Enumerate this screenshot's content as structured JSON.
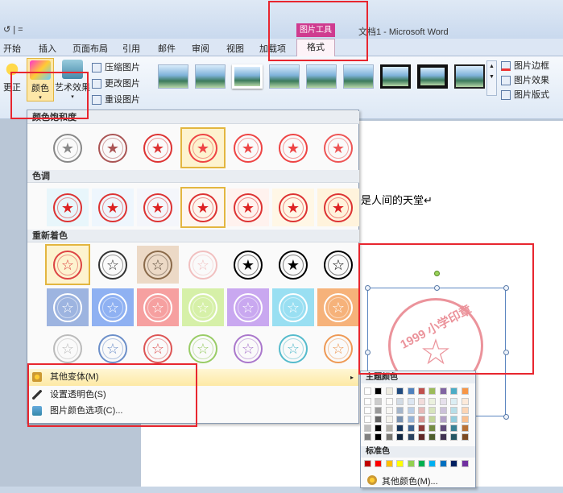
{
  "window": {
    "title": "文档1 - Microsoft Word",
    "quick_access": "↺ | ="
  },
  "context_group": "图片工具",
  "tabs": [
    "开始",
    "插入",
    "页面布局",
    "引用",
    "邮件",
    "审阅",
    "视图",
    "加载项",
    "格式"
  ],
  "active_tab": "格式",
  "ribbon": {
    "adjust": {
      "correct_label": "更正",
      "color_label": "颜色",
      "artistic_label": "艺术效果",
      "compress_label": "压缩图片",
      "change_label": "更改图片",
      "reset_label": "重设图片"
    },
    "right": {
      "border_label": "图片边框",
      "effects_label": "图片效果",
      "layout_label": "图片版式"
    }
  },
  "color_panel": {
    "sections": [
      "颜色饱和度",
      "色调",
      "重新着色"
    ],
    "stamp_text": "1999 小学印章"
  },
  "menu": {
    "more_variations": "其他变体(M)",
    "set_transparent": "设置透明色(S)",
    "color_options": "图片颜色选项(C)..."
  },
  "submenu": {
    "theme_label": "主题颜色",
    "standard_label": "标准色",
    "more_colors": "其他颜色(M)...",
    "theme_top": [
      "#ffffff",
      "#000000",
      "#eeece1",
      "#1f497d",
      "#4f81bd",
      "#c0504d",
      "#9bbb59",
      "#8064a2",
      "#4bacc6",
      "#f79646"
    ],
    "standard": [
      "#c00000",
      "#ff0000",
      "#ffc000",
      "#ffff00",
      "#92d050",
      "#00b050",
      "#00b0f0",
      "#0070c0",
      "#002060",
      "#7030a0"
    ]
  },
  "document": {
    "text": "是人间的天堂↵"
  },
  "colors": {
    "highlight": "#e8262f",
    "stamp_red": "#d63a3a",
    "selection": "#e3b640"
  }
}
